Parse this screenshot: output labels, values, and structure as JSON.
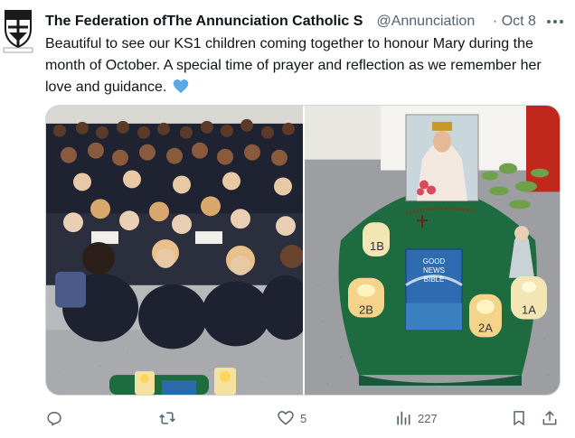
{
  "tweet": {
    "author_name": "The Federation ofThe Annunciation Catholic S",
    "handle": "@Annunciation",
    "separator": "·",
    "date": "Oct 8",
    "text": "Beautiful to see our KS1 children coming together to honour Mary during the month of October. A special time of prayer and reflection as we remember her love and guidance.",
    "emoji": "blue-heart"
  },
  "media": {
    "left_photo": "children-seated-photo",
    "right_photo": "prayer-table-photo",
    "book_title_line1": "GOOD",
    "book_title_line2": "NEWS",
    "book_title_line3": "BIBLE",
    "candle_labels": [
      "1B",
      "2B",
      "2A",
      "1A"
    ]
  },
  "actions": {
    "reply_icon": "reply-icon",
    "retweet_icon": "retweet-icon",
    "like_icon": "heart-icon",
    "like_count": "5",
    "views_icon": "views-icon",
    "views_count": "227",
    "bookmark_icon": "bookmark-icon",
    "share_icon": "share-icon"
  },
  "colors": {
    "text": "#0f1419",
    "muted": "#536471",
    "heart": "#5aa9e6",
    "cloth": "#1e6b3f"
  }
}
